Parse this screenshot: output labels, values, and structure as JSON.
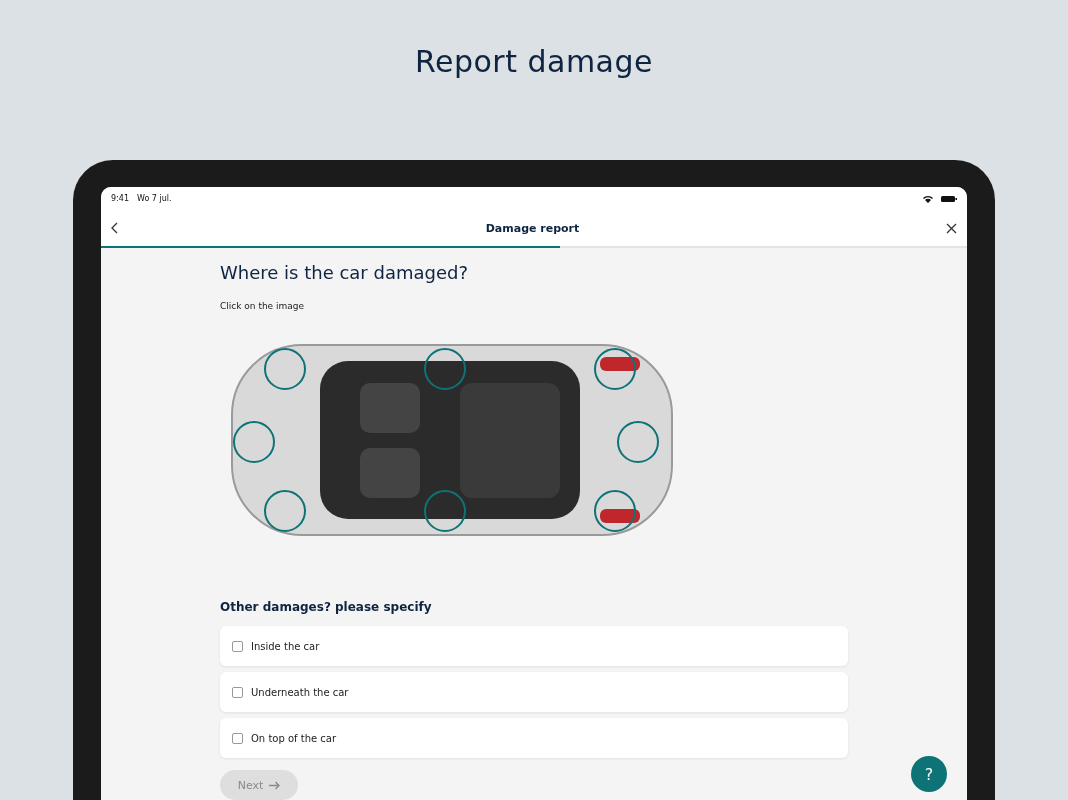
{
  "page_title": "Report damage",
  "status_bar": {
    "time": "9:41",
    "date": "Wo 7 jul."
  },
  "header": {
    "title": "Damage report",
    "progress": {
      "level": 0.53
    }
  },
  "question": {
    "title": "Where is the car damaged?",
    "hint": "Click on the image"
  },
  "other": {
    "title": "Other damages? please specify",
    "options": [
      {
        "label": "Inside the car",
        "checked": false
      },
      {
        "label": "Underneath the car",
        "checked": false
      },
      {
        "label": "On top of the car",
        "checked": false
      }
    ]
  },
  "next_button": {
    "label": "Next",
    "disabled": true
  },
  "help_button": {
    "label": "?"
  }
}
